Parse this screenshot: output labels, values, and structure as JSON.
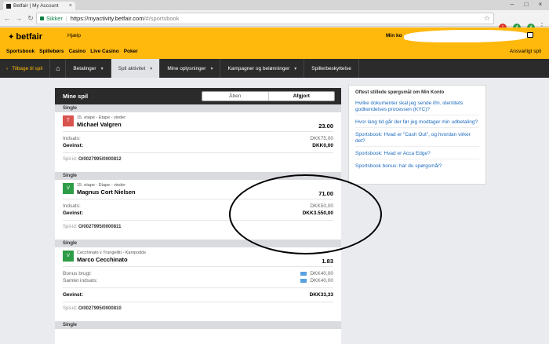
{
  "browser": {
    "tab_title": "Betfair | My Account",
    "secure_label": "Sikker",
    "url_host": "https://myactivity.betfair.com",
    "url_path": "/#/sportsbook",
    "ext_badges": [
      "1",
      "4",
      "4"
    ]
  },
  "header": {
    "logo_text": "betfair",
    "help": "Hjælp",
    "account_name": "Min ko",
    "product_nav": [
      "Sportsbook",
      "Spillebørs",
      "Casino",
      "Live Casino",
      "Poker"
    ],
    "responsible": "Ansvarligt spil"
  },
  "nav": {
    "back": "Tilbage til spil",
    "items": [
      "Betalinger",
      "Spil aktivitet",
      "Mine oplysninger",
      "Kampagner og belønninger",
      "Spillerbeskyttelse"
    ]
  },
  "panel": {
    "title": "Mine spil",
    "tabs": [
      "Åben",
      "Afgjort"
    ]
  },
  "bets": [
    {
      "type": "Single",
      "result": "T",
      "event": "15. etape - Etape - vinder",
      "selection": "Michael Valgren",
      "odds": "23.00",
      "stake_label": "Indsats:",
      "stake": "DKK75,00",
      "win_label": "Gevinst:",
      "win": "DKK0,00",
      "id_label": "Spil-id:",
      "id": "O/0027995/0000812"
    },
    {
      "type": "Single",
      "result": "V",
      "event": "15. etape - Etape - vinder",
      "selection": "Magnus Cort Nielsen",
      "odds": "71.00",
      "stake_label": "Indsats:",
      "stake": "DKK50,00",
      "win_label": "Gevinst:",
      "win": "DKK3.550,00",
      "id_label": "Spil-id:",
      "id": "O/0027995/0000811"
    },
    {
      "type": "Single",
      "result": "V",
      "event": "Cecchinato v Trungelliti - Kampodds",
      "selection": "Marco Cecchinato",
      "odds": "1.83",
      "bonus_label": "Bonus brugt:",
      "bonus": "DKK40,00",
      "total_label": "Samlet indsats:",
      "total": "DKK40,00",
      "win_label": "Gevinst:",
      "win": "DKK33,33",
      "id_label": "Spil-id:",
      "id": "O/0027995/0000810"
    },
    {
      "type": "Single"
    }
  ],
  "faq": {
    "title": "Oftest stillede spørgsmål om Min Konto",
    "links": [
      "Hvilke dokumenter skal jeg sende ifm. identitets godkendelses processen (KYC)?",
      "Hvor lang tid går der før jeg modtager min udbetaling?",
      "Sportsbook: Hvad er \"Cash Out\", og hvordan virker det?",
      "Sportsbook: Hvad er Acca Edge?",
      "Sportsbook bonus: har du spørgsmål?"
    ]
  },
  "colors": {
    "brand": "#ffb80c",
    "dark_nav": "#2b2b2b",
    "won": "#2f9d47",
    "lost": "#d9534f",
    "link": "#1e6bbf"
  }
}
